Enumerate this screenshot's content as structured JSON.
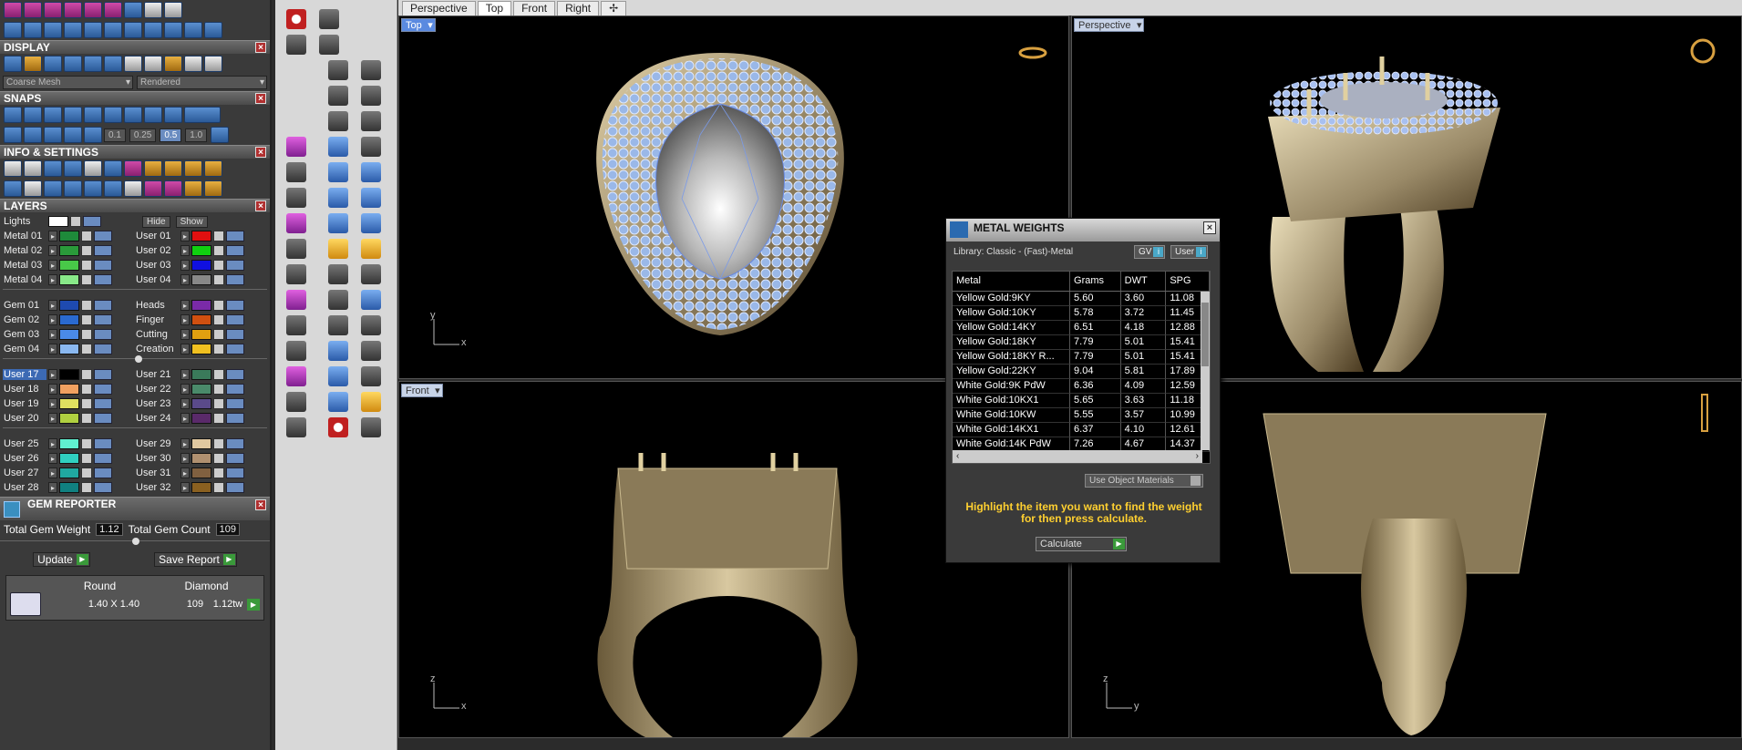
{
  "left_panel": {
    "display": {
      "title": "DISPLAY",
      "mesh": "Coarse Mesh",
      "render": "Rendered"
    },
    "snaps": {
      "title": "SNAPS",
      "values": [
        "0.1",
        "0.25",
        "0.5",
        "1.0"
      ]
    },
    "info_settings": {
      "title": "INFO & SETTINGS"
    },
    "layers": {
      "title": "LAYERS",
      "lights": "Lights",
      "hide": "Hide",
      "show": "Show",
      "groups": [
        {
          "rows": [
            {
              "l": "Metal 01",
              "lc": "#1e8a3a",
              "r": "User 01",
              "rc": "#e01010"
            },
            {
              "l": "Metal 02",
              "lc": "#2a9a3a",
              "r": "User 02",
              "rc": "#10d010"
            },
            {
              "l": "Metal 03",
              "lc": "#48c848",
              "r": "User 03",
              "rc": "#1010e0"
            },
            {
              "l": "Metal 04",
              "lc": "#88e888",
              "r": "User 04",
              "rc": "#888888"
            }
          ]
        },
        {
          "rows": [
            {
              "l": "Gem 01",
              "lc": "#1e4ab0",
              "r": "Heads",
              "rc": "#7a2aa8"
            },
            {
              "l": "Gem 02",
              "lc": "#2a6ad0",
              "r": "Finger",
              "rc": "#d05010"
            },
            {
              "l": "Gem 03",
              "lc": "#4a8ae8",
              "r": "Cutting",
              "rc": "#e0a010"
            },
            {
              "l": "Gem 04",
              "lc": "#8ab8f0",
              "r": "Creation",
              "rc": "#f0c020"
            }
          ]
        },
        {
          "rows": [
            {
              "l": "User 17",
              "lc": "#000000",
              "r": "User 21",
              "rc": "#3a7a5a",
              "sel": true
            },
            {
              "l": "User 18",
              "lc": "#f0a060",
              "r": "User 22",
              "rc": "#4a8a6a"
            },
            {
              "l": "User 19",
              "lc": "#e0e060",
              "r": "User 23",
              "rc": "#5a4a8a"
            },
            {
              "l": "User 20",
              "lc": "#b0d040",
              "r": "User 24",
              "rc": "#5a2a6a"
            }
          ]
        },
        {
          "rows": [
            {
              "l": "User 25",
              "lc": "#60f0d0",
              "r": "User 29",
              "rc": "#e0c8a0"
            },
            {
              "l": "User 26",
              "lc": "#30d0c0",
              "r": "User 30",
              "rc": "#b09070"
            },
            {
              "l": "User 27",
              "lc": "#20a8a0",
              "r": "User 31",
              "rc": "#806040"
            },
            {
              "l": "User 28",
              "lc": "#108080",
              "r": "User 32",
              "rc": "#8a6020"
            }
          ]
        }
      ]
    },
    "gem_reporter": {
      "title": "GEM REPORTER",
      "total_weight_label": "Total Gem Weight",
      "total_weight": "1.12",
      "total_count_label": "Total Gem Count",
      "total_count": "109",
      "update": "Update",
      "save": "Save Report",
      "shape": "Round",
      "type": "Diamond",
      "size": "1.40 X 1.40",
      "count": "109",
      "tw": "1.12tw"
    }
  },
  "viewport_tabs": [
    "Perspective",
    "Top",
    "Front",
    "Right"
  ],
  "active_tab": "Top",
  "viewports": {
    "top": "Top",
    "perspective": "Perspective",
    "front": "Front",
    "axes": {
      "x": "x",
      "y": "y",
      "z": "z"
    }
  },
  "metal_weights": {
    "title": "METAL WEIGHTS",
    "library": "Library: Classic - (Fast)-Metal",
    "gv": "GV",
    "user": "User",
    "columns": [
      "Metal",
      "Grams",
      "DWT",
      "SPG"
    ],
    "rows": [
      [
        "Yellow Gold:9KY",
        "5.60",
        "3.60",
        "11.08"
      ],
      [
        "Yellow Gold:10KY",
        "5.78",
        "3.72",
        "11.45"
      ],
      [
        "Yellow Gold:14KY",
        "6.51",
        "4.18",
        "12.88"
      ],
      [
        "Yellow Gold:18KY",
        "7.79",
        "5.01",
        "15.41"
      ],
      [
        "Yellow Gold:18KY R...",
        "7.79",
        "5.01",
        "15.41"
      ],
      [
        "Yellow Gold:22KY",
        "9.04",
        "5.81",
        "17.89"
      ],
      [
        "White Gold:9K PdW",
        "6.36",
        "4.09",
        "12.59"
      ],
      [
        "White Gold:10KX1",
        "5.65",
        "3.63",
        "11.18"
      ],
      [
        "White Gold:10KW",
        "5.55",
        "3.57",
        "10.99"
      ],
      [
        "White Gold:14KX1",
        "6.37",
        "4.10",
        "12.61"
      ],
      [
        "White Gold:14K PdW",
        "7.26",
        "4.67",
        "14.37"
      ]
    ],
    "use_materials": "Use Object Materials",
    "hint": "Highlight the item you want to find the weight for then press calculate.",
    "calculate": "Calculate"
  }
}
